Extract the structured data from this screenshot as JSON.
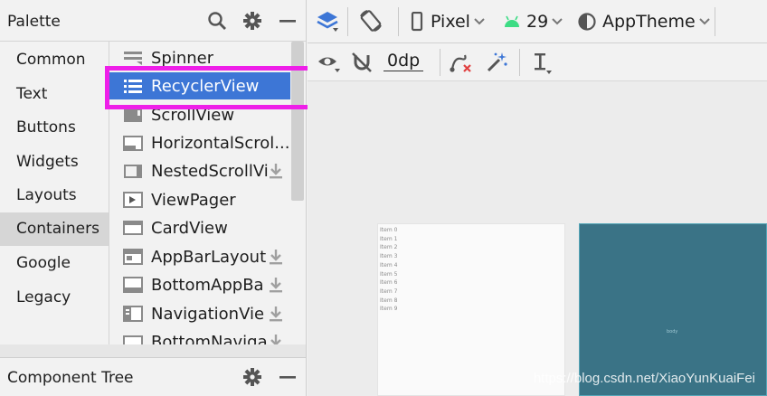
{
  "palette": {
    "title": "Palette",
    "categories": [
      "Common",
      "Text",
      "Buttons",
      "Widgets",
      "Layouts",
      "Containers",
      "Google",
      "Legacy"
    ],
    "selected_category": "Containers",
    "widgets": [
      {
        "label": "Spinner",
        "icon": "spinner-icon",
        "download": false
      },
      {
        "label": "RecyclerView",
        "icon": "recyclerview-icon",
        "download": false,
        "selected": true
      },
      {
        "label": "ScrollView",
        "icon": "scrollview-icon",
        "download": false
      },
      {
        "label": "HorizontalScrol...",
        "icon": "horizontal-scrollview-icon",
        "download": false
      },
      {
        "label": "NestedScrollVi",
        "icon": "nested-scrollview-icon",
        "download": true
      },
      {
        "label": "ViewPager",
        "icon": "viewpager-icon",
        "download": false
      },
      {
        "label": "CardView",
        "icon": "cardview-icon",
        "download": false
      },
      {
        "label": "AppBarLayout",
        "icon": "appbarlayout-icon",
        "download": true
      },
      {
        "label": "BottomAppBa",
        "icon": "bottomappbar-icon",
        "download": true
      },
      {
        "label": "NavigationVie",
        "icon": "navigationview-icon",
        "download": true
      },
      {
        "label": "BottomNaviga",
        "icon": "bottomnavigation-icon",
        "download": true
      }
    ]
  },
  "component_tree": {
    "title": "Component Tree"
  },
  "toolbar": {
    "device": "Pixel",
    "api": "29",
    "theme": "AppTheme",
    "margin": "0dp"
  },
  "canvas": {
    "recycler_items": [
      "Item 0",
      "Item 1",
      "Item 2",
      "Item 3",
      "Item 4",
      "Item 5",
      "Item 6",
      "Item 7",
      "Item 8",
      "Item 9"
    ],
    "blueprint_label": "body"
  },
  "watermark": "https://blog.csdn.net/XiaoYunKuaiFei",
  "colors": {
    "selection": "#3d76d6",
    "highlight_box": "#ee1fe8",
    "blueprint": "#3a7386",
    "android_green": "#3ddc84"
  }
}
